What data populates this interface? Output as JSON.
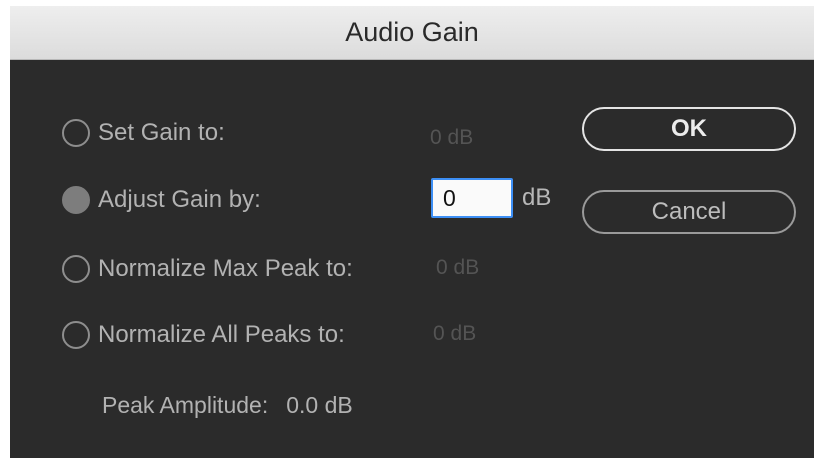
{
  "dialog": {
    "title": "Audio Gain"
  },
  "options": [
    {
      "label": "Set Gain to:",
      "value": "0 dB",
      "selected": false
    },
    {
      "label": "Adjust Gain by:",
      "value": "0",
      "unit": "dB",
      "selected": true
    },
    {
      "label": "Normalize Max Peak to:",
      "value": "0 dB",
      "selected": false
    },
    {
      "label": "Normalize All Peaks to:",
      "value": "0 dB",
      "selected": false
    }
  ],
  "buttons": {
    "ok_label": "OK",
    "cancel_label": "Cancel"
  },
  "peak": {
    "label": "Peak Amplitude:",
    "value": "0.0 dB"
  },
  "colors": {
    "dialog_bg": "#2b2b2b",
    "input_focus": "#3d8ff5"
  }
}
